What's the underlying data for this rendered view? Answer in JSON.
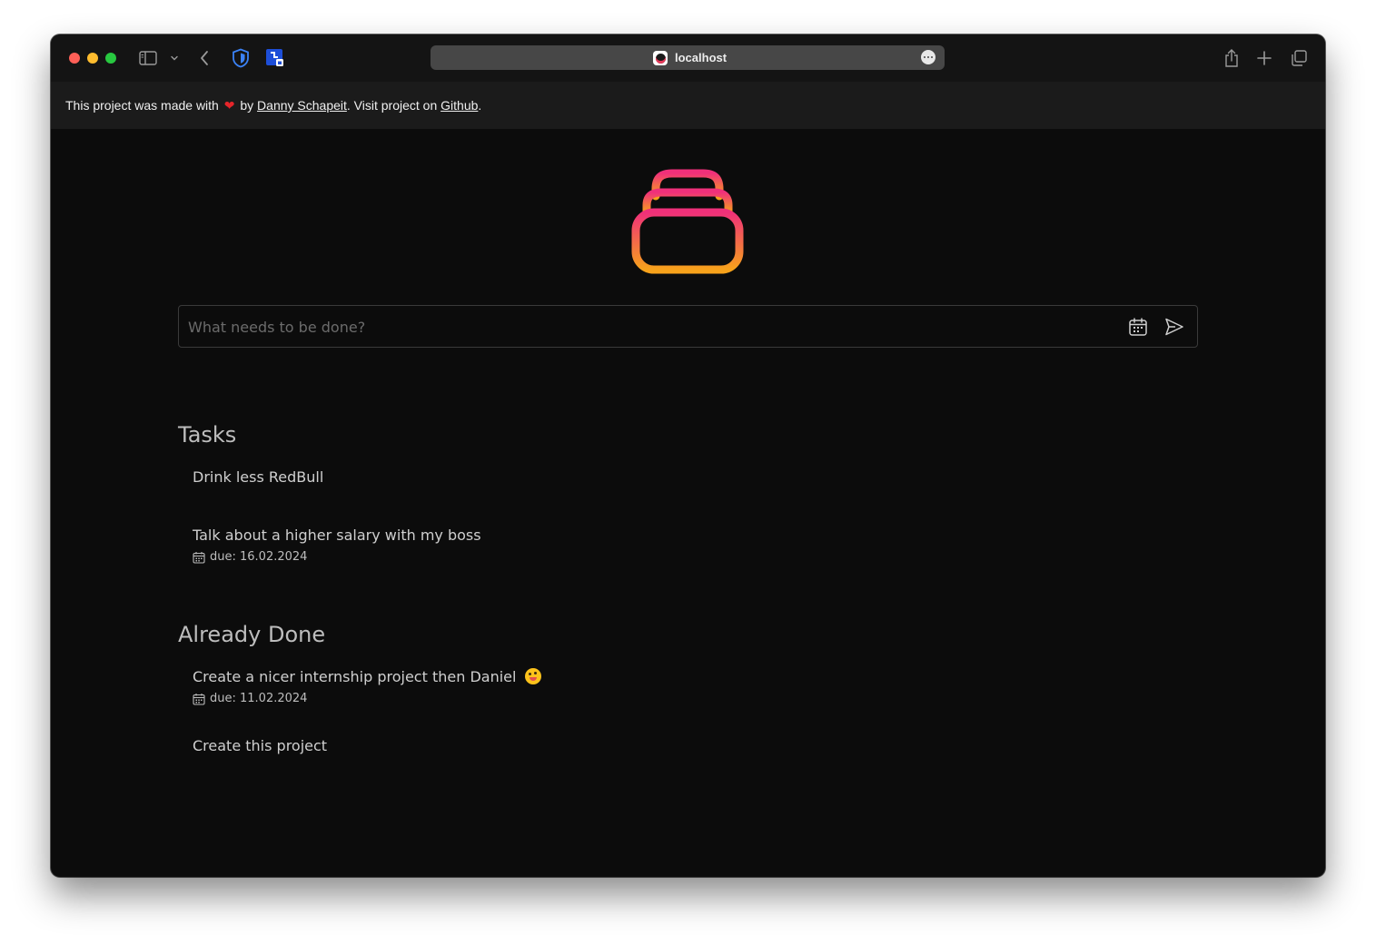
{
  "browser": {
    "url": "localhost",
    "icons": [
      "sidebar-icon",
      "chevron-down-icon",
      "back-icon",
      "shield-icon",
      "extension-icon",
      "more-icon",
      "share-icon",
      "new-tab-icon",
      "tabs-overview-icon"
    ]
  },
  "attribution": {
    "prefix": "This project was made with",
    "heart": "❤",
    "by": "by",
    "author": "Danny Schapeit",
    "middle": ". Visit project on",
    "github": "Github",
    "suffix": "."
  },
  "input": {
    "placeholder": "What needs to be done?",
    "calendar_icon": "calendar-icon",
    "send_icon": "send-icon"
  },
  "sections": {
    "tasks": {
      "title": "Tasks",
      "items": [
        {
          "text": "Drink less RedBull"
        },
        {
          "text": "Talk about a higher salary with my boss",
          "due": "due: 16.02.2024"
        }
      ]
    },
    "done": {
      "title": "Already Done",
      "items": [
        {
          "text": "Create a nicer internship project then Daniel",
          "emoji": "winking-tongue-emoji",
          "due": "due: 11.02.2024"
        },
        {
          "text": "Create this project"
        }
      ]
    }
  },
  "colors": {
    "background": "#0c0c0c",
    "attribution_bg": "#1b1b1b",
    "logo_gradient_top": "#f0307a",
    "logo_gradient_bottom": "#f7a21b",
    "heart": "#e5252a"
  }
}
